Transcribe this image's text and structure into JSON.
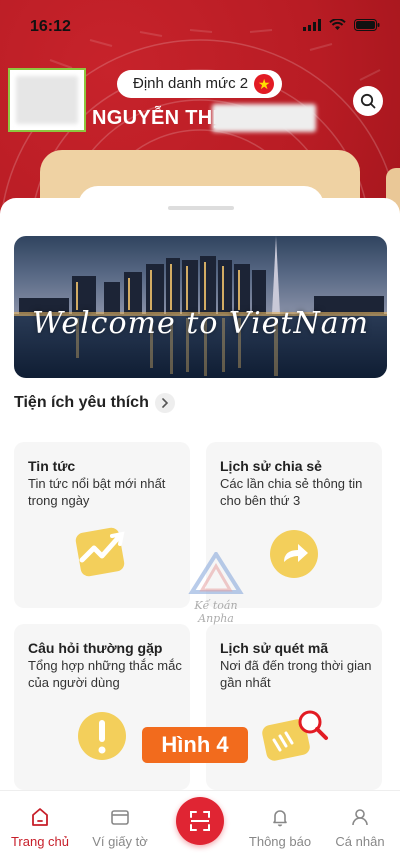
{
  "status_bar": {
    "time": "16:12",
    "icons": [
      "signal-icon",
      "wifi-icon",
      "battery-icon"
    ]
  },
  "header": {
    "identity_level": "Định danh mức 2",
    "identity_badge_icon": "star-icon",
    "user_name": "NGUYỄN THỊ",
    "search_icon": "search-icon"
  },
  "banner": {
    "text": "Welcome to VietNam"
  },
  "favorites": {
    "title": "Tiện ích yêu thích",
    "cards": [
      {
        "title": "Tin tức",
        "description": "Tin tức nổi bật mới nhất trong ngày",
        "icon": "news-trend-icon"
      },
      {
        "title": "Lịch sử chia sẻ",
        "description": "Các lần chia sẻ thông tin cho bên thứ 3",
        "icon": "share-arrow-icon"
      },
      {
        "title": "Câu hỏi thường gặp",
        "description": "Tổng hợp những thắc mắc của người dùng",
        "icon": "faq-exclamation-icon"
      },
      {
        "title": "Lịch sử quét mã",
        "description": "Nơi đã đến trong thời gian gần nhất",
        "icon": "scan-history-icon"
      }
    ]
  },
  "watermark": {
    "text": "Kế toán Anpha"
  },
  "overlay_badge": "Hình 4",
  "bottom_nav": {
    "items": [
      {
        "label": "Trang chủ",
        "icon": "home-icon",
        "active": true
      },
      {
        "label": "Ví giấy tờ",
        "icon": "wallet-icon",
        "active": false
      },
      {
        "label": "Thông báo",
        "icon": "bell-icon",
        "active": false
      },
      {
        "label": "Cá nhân",
        "icon": "profile-icon",
        "active": false
      }
    ],
    "scan_icon": "qr-scan-icon"
  },
  "colors": {
    "header_red": "#b81c24",
    "accent_red": "#e02533",
    "active_nav": "#c71f2a",
    "card_beige": "#efd2a3",
    "badge_orange": "#f26b1d"
  }
}
